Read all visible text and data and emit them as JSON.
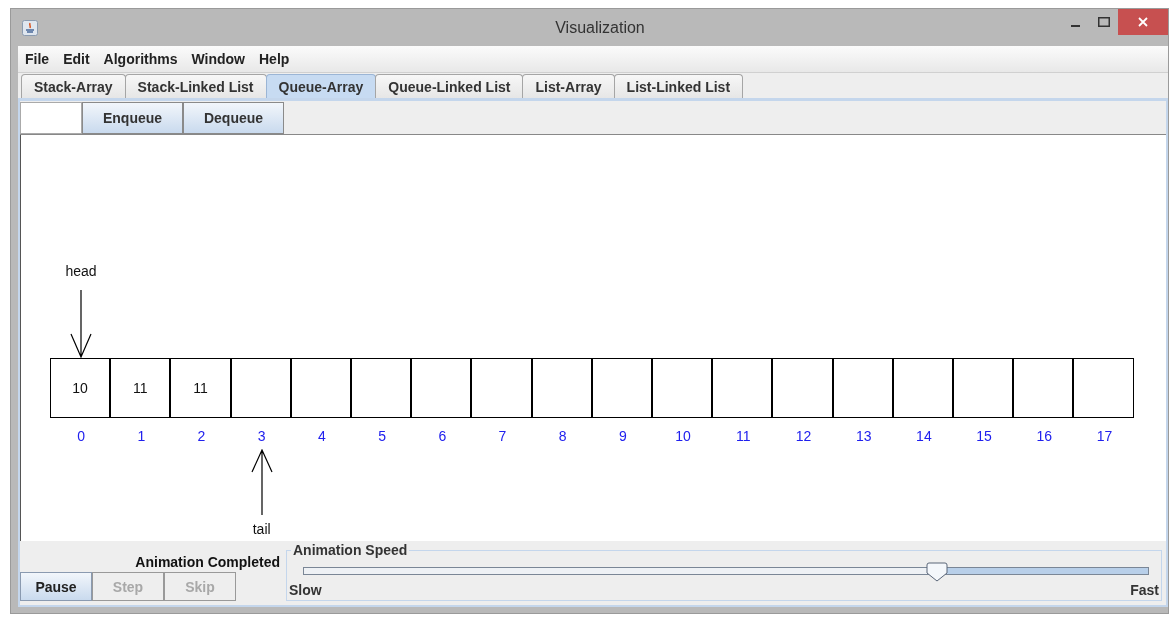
{
  "window": {
    "title": "Visualization"
  },
  "menu": [
    "File",
    "Edit",
    "Algorithms",
    "Window",
    "Help"
  ],
  "tabs": [
    {
      "label": "Stack-Array",
      "selected": false
    },
    {
      "label": "Stack-Linked List",
      "selected": false
    },
    {
      "label": "Queue-Array",
      "selected": true
    },
    {
      "label": "Queue-Linked List",
      "selected": false
    },
    {
      "label": "List-Array",
      "selected": false
    },
    {
      "label": "List-Linked List",
      "selected": false
    }
  ],
  "toolbar": {
    "buttons": [
      "Enqueue",
      "Dequeue"
    ]
  },
  "array": {
    "cells": [
      {
        "value": "10",
        "index": "0",
        "pointer": {
          "kind": "above",
          "label": "head"
        }
      },
      {
        "value": "11",
        "index": "1"
      },
      {
        "value": "11",
        "index": "2"
      },
      {
        "index": "3",
        "pointer": {
          "kind": "below",
          "label": "tail"
        }
      },
      {
        "index": "4"
      },
      {
        "index": "5"
      },
      {
        "index": "6"
      },
      {
        "index": "7"
      },
      {
        "index": "8"
      },
      {
        "index": "9"
      },
      {
        "index": "10"
      },
      {
        "index": "11"
      },
      {
        "index": "12"
      },
      {
        "index": "13"
      },
      {
        "index": "14"
      },
      {
        "index": "15"
      },
      {
        "index": "16"
      },
      {
        "index": "17"
      }
    ]
  },
  "status": "Animation Completed",
  "controls": [
    {
      "label": "Pause",
      "disabled": false
    },
    {
      "label": "Step",
      "disabled": true
    },
    {
      "label": "Skip",
      "disabled": true
    }
  ],
  "speed": {
    "title": "Animation Speed",
    "level": 0.75,
    "min_label": "Slow",
    "max_label": "Fast"
  }
}
